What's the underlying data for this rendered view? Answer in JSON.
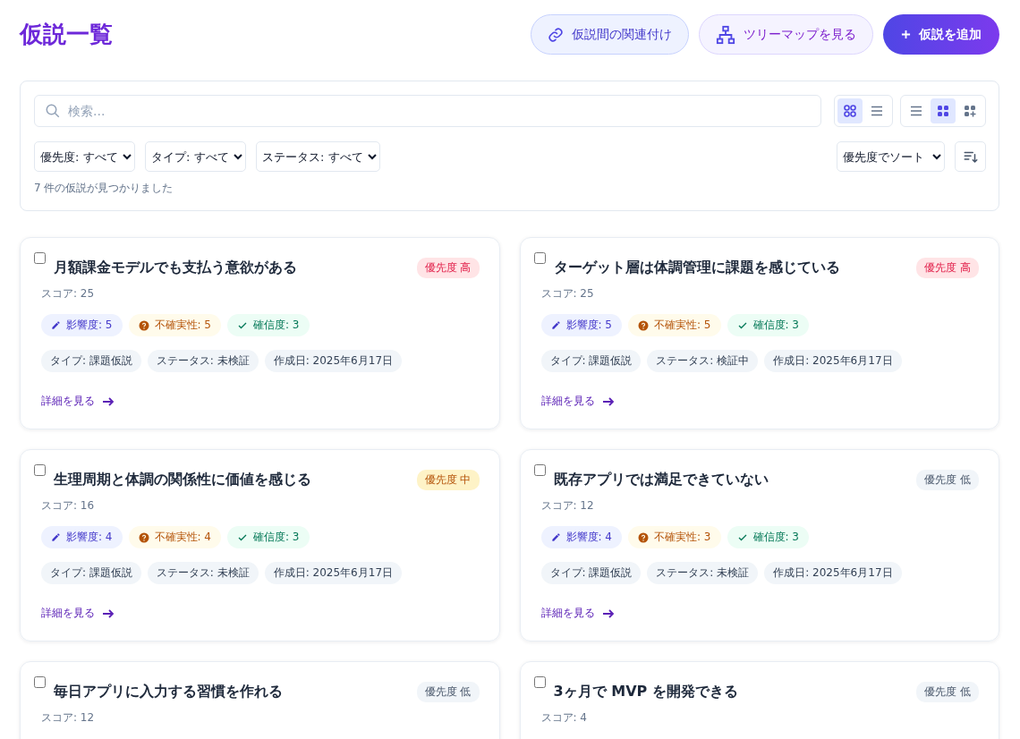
{
  "page": {
    "title": "仮説一覧"
  },
  "actions": [
    {
      "kind": "link",
      "label": "仮説間の関連付け"
    },
    {
      "kind": "tree",
      "label": "ツリーマップを見る"
    },
    {
      "kind": "add",
      "label": "仮説を追加"
    }
  ],
  "search": {
    "placeholder": "検索..."
  },
  "view_toggle_a": [
    {
      "kind": "cards",
      "selected": true
    },
    {
      "kind": "list",
      "selected": false
    }
  ],
  "view_toggle_b": [
    {
      "kind": "list",
      "selected": false
    },
    {
      "kind": "grid",
      "selected": true
    },
    {
      "kind": "grid-plus",
      "selected": false
    }
  ],
  "filters": [
    "優先度: すべて",
    "タイプ: すべて",
    "ステータス: すべて"
  ],
  "sort": "優先度でソート",
  "result_count": "7 件の仮説が見つかりました",
  "cards": [
    {
      "title": "月額課金モデルでも支払う意欲がある",
      "checked": false,
      "priority": {
        "kind": "high",
        "label": "優先度 高"
      },
      "score": "スコア: 25",
      "metrics": [
        {
          "kind": "impact",
          "label": "影響度: 5"
        },
        {
          "kind": "uncertainty",
          "label": "不確実性: 5"
        },
        {
          "kind": "confidence",
          "label": "確信度: 3"
        }
      ],
      "tags": [
        "タイプ: 課題仮説",
        "ステータス: 未検証",
        "作成日: 2025年6月17日"
      ],
      "link": "詳細を見る"
    },
    {
      "title": "ターゲット層は体調管理に課題を感じている",
      "checked": false,
      "priority": {
        "kind": "high",
        "label": "優先度 高"
      },
      "score": "スコア: 25",
      "metrics": [
        {
          "kind": "impact",
          "label": "影響度: 5"
        },
        {
          "kind": "uncertainty",
          "label": "不確実性: 5"
        },
        {
          "kind": "confidence",
          "label": "確信度: 3"
        }
      ],
      "tags": [
        "タイプ: 課題仮説",
        "ステータス: 検証中",
        "作成日: 2025年6月17日"
      ],
      "link": "詳細を見る"
    },
    {
      "title": "生理周期と体調の関係性に価値を感じる",
      "checked": false,
      "priority": {
        "kind": "medium",
        "label": "優先度 中"
      },
      "score": "スコア: 16",
      "metrics": [
        {
          "kind": "impact",
          "label": "影響度: 4"
        },
        {
          "kind": "uncertainty",
          "label": "不確実性: 4"
        },
        {
          "kind": "confidence",
          "label": "確信度: 3"
        }
      ],
      "tags": [
        "タイプ: 課題仮説",
        "ステータス: 未検証",
        "作成日: 2025年6月17日"
      ],
      "link": "詳細を見る"
    },
    {
      "title": "既存アプリでは満足できていない",
      "checked": false,
      "priority": {
        "kind": "low",
        "label": "優先度 低"
      },
      "score": "スコア: 12",
      "metrics": [
        {
          "kind": "impact",
          "label": "影響度: 4"
        },
        {
          "kind": "uncertainty",
          "label": "不確実性: 3"
        },
        {
          "kind": "confidence",
          "label": "確信度: 3"
        }
      ],
      "tags": [
        "タイプ: 課題仮説",
        "ステータス: 未検証",
        "作成日: 2025年6月17日"
      ],
      "link": "詳細を見る"
    },
    {
      "title": "毎日アプリに入力する習慣を作れる",
      "checked": false,
      "priority": {
        "kind": "low",
        "label": "優先度 低"
      },
      "score": "スコア: 12"
    },
    {
      "title": "3ヶ月で MVP を開発できる",
      "checked": false,
      "priority": {
        "kind": "low",
        "label": "優先度 低"
      },
      "score": "スコア: 4"
    }
  ]
}
